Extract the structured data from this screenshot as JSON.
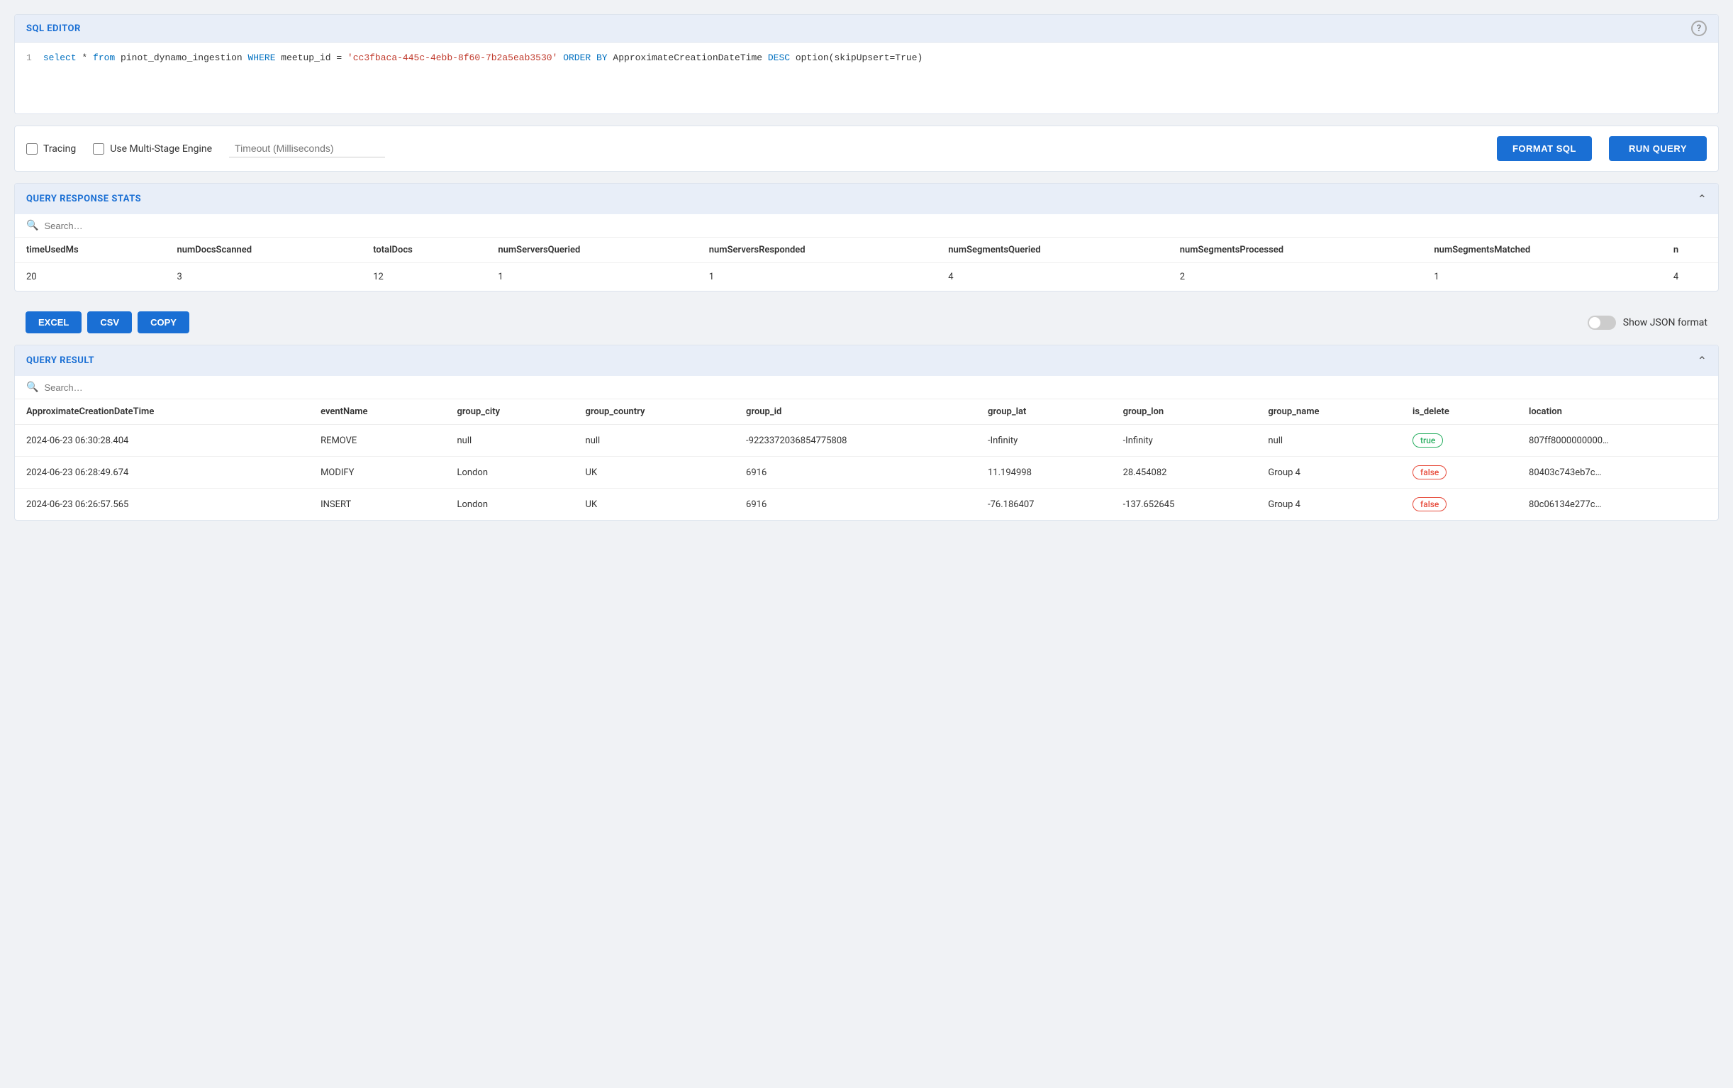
{
  "sqlEditor": {
    "title": "SQL EDITOR",
    "helpLabel": "?",
    "query": "select * from pinot_dynamo_ingestion WHERE meetup_id = 'cc3fbaca-445c-4ebb-8f60-7b2a5eab3530' ORDER BY ApproximateCreationDateTime DESC option(skipUpsert=True)",
    "lineNumber": "1"
  },
  "controls": {
    "tracingLabel": "Tracing",
    "multiStageLabel": "Use Multi-Stage Engine",
    "timeoutPlaceholder": "Timeout (Milliseconds)",
    "formatSqlLabel": "FORMAT SQL",
    "runQueryLabel": "RUN QUERY"
  },
  "queryResponseStats": {
    "title": "QUERY RESPONSE STATS",
    "searchPlaceholder": "Search…",
    "columns": [
      "timeUsedMs",
      "numDocsScanned",
      "totalDocs",
      "numServersQueried",
      "numServersResponded",
      "numSegmentsQueried",
      "numSegmentsProcessed",
      "numSegmentsMatched",
      "n"
    ],
    "row": [
      "20",
      "3",
      "12",
      "1",
      "1",
      "4",
      "2",
      "1",
      "4"
    ]
  },
  "exportButtons": {
    "excelLabel": "EXCEL",
    "csvLabel": "CSV",
    "copyLabel": "COPY",
    "showJsonLabel": "Show JSON format"
  },
  "queryResult": {
    "title": "QUERY RESULT",
    "searchPlaceholder": "Search…",
    "columns": [
      "ApproximateCreationDateTime",
      "eventName",
      "group_city",
      "group_country",
      "group_id",
      "group_lat",
      "group_lon",
      "group_name",
      "is_delete",
      "location"
    ],
    "rows": [
      {
        "ApproximateCreationDateTime": "2024-06-23 06:30:28.404",
        "eventName": "REMOVE",
        "group_city": "null",
        "group_country": "null",
        "group_id": "-9223372036854775808",
        "group_lat": "-Infinity",
        "group_lon": "-Infinity",
        "group_name": "null",
        "is_delete": "true",
        "is_delete_type": "true",
        "location": "807ff8000000000…"
      },
      {
        "ApproximateCreationDateTime": "2024-06-23 06:28:49.674",
        "eventName": "MODIFY",
        "group_city": "London",
        "group_country": "UK",
        "group_id": "6916",
        "group_lat": "11.194998",
        "group_lon": "28.454082",
        "group_name": "Group 4",
        "is_delete": "false",
        "is_delete_type": "false",
        "location": "80403c743eb7c…"
      },
      {
        "ApproximateCreationDateTime": "2024-06-23 06:26:57.565",
        "eventName": "INSERT",
        "group_city": "London",
        "group_country": "UK",
        "group_id": "6916",
        "group_lat": "-76.186407",
        "group_lon": "-137.652645",
        "group_name": "Group 4",
        "is_delete": "false",
        "is_delete_type": "false",
        "location": "80c06134e277c…"
      }
    ]
  }
}
